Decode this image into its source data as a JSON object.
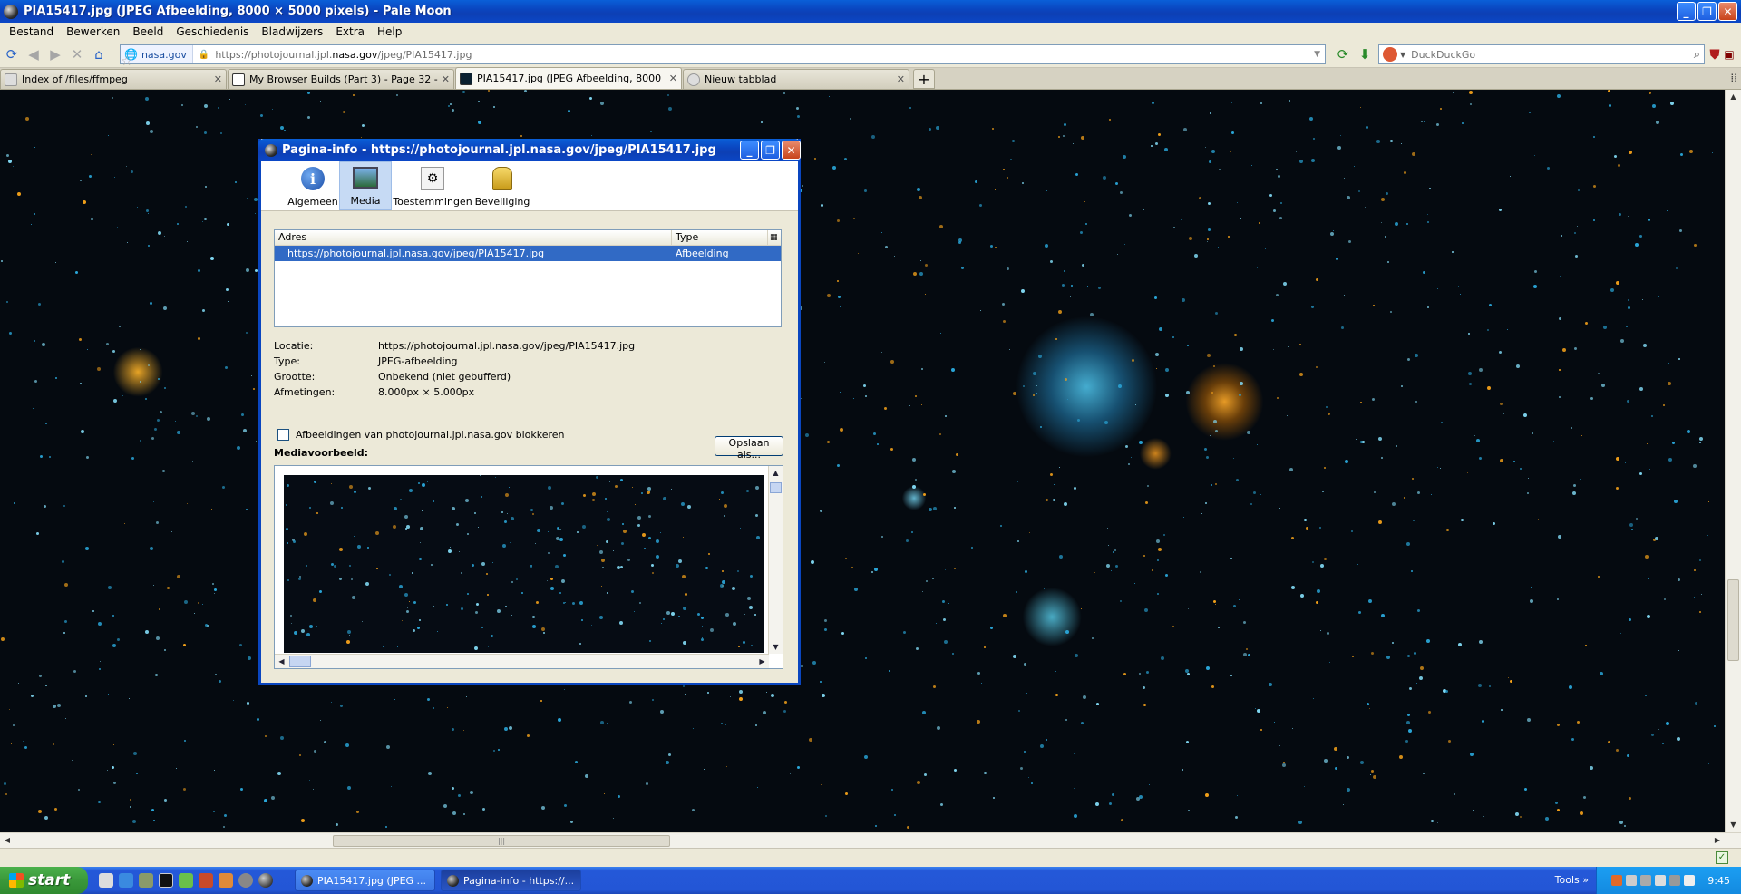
{
  "window": {
    "title": "PIA15417.jpg (JPEG Afbeelding, 8000 × 5000 pixels) - Pale Moon"
  },
  "menu": [
    "Bestand",
    "Bewerken",
    "Beeld",
    "Geschiedenis",
    "Bladwijzers",
    "Extra",
    "Help"
  ],
  "nav": {
    "identity": "nasa.gov",
    "url_prefix": "https://photojournal.jpl.",
    "url_domain": "nasa.gov",
    "url_path": "/jpeg/PIA15417.jpg",
    "search_placeholder": "DuckDuckGo"
  },
  "tabs": [
    {
      "label": "Index of /files/ffmpeg"
    },
    {
      "label": "My Browser Builds (Part 3) - Page 32 - Wi..."
    },
    {
      "label": "PIA15417.jpg (JPEG Afbeelding, 8000 ×..."
    },
    {
      "label": "Nieuw tabblad"
    }
  ],
  "dialog": {
    "title": "Pagina-info - https://photojournal.jpl.nasa.gov/jpeg/PIA15417.jpg",
    "tabs": [
      "Algemeen",
      "Media",
      "Toestemmingen",
      "Beveiliging"
    ],
    "columns": {
      "address": "Adres",
      "type": "Type"
    },
    "row": {
      "address": "https://photojournal.jpl.nasa.gov/jpeg/PIA15417.jpg",
      "type": "Afbeelding"
    },
    "props": [
      {
        "k": "Locatie:",
        "v": "https://photojournal.jpl.nasa.gov/jpeg/PIA15417.jpg"
      },
      {
        "k": "Type:",
        "v": "JPEG-afbeelding"
      },
      {
        "k": "Grootte:",
        "v": "Onbekend (niet gebufferd)"
      },
      {
        "k": "Afmetingen:",
        "v": "8.000px × 5.000px"
      }
    ],
    "block_label": "Afbeeldingen van photojournal.jpl.nasa.gov blokkeren",
    "save_label": "Opslaan als...",
    "preview_label": "Mediavoorbeeld:"
  },
  "taskbar": {
    "start": "start",
    "items": [
      "PIA15417.jpg (JPEG ...",
      "Pagina-info - https://..."
    ],
    "tools": "Tools",
    "clock": "9:45"
  }
}
